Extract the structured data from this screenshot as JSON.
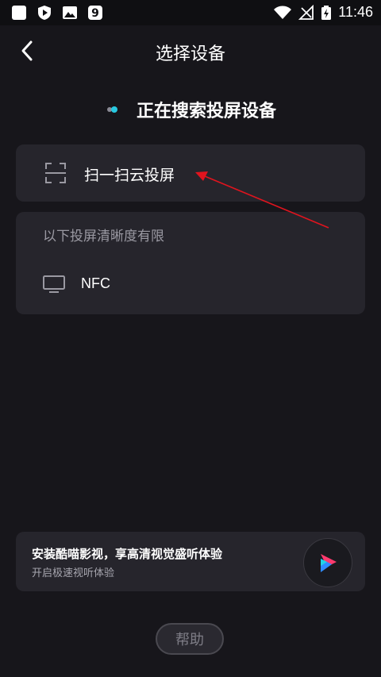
{
  "status_bar": {
    "time": "11:46"
  },
  "nav": {
    "title": "选择设备"
  },
  "searching": {
    "text": "正在搜索投屏设备"
  },
  "scan_card": {
    "label": "扫一扫云投屏"
  },
  "limited_card": {
    "label": "以下投屏清晰度有限",
    "nfc_label": "NFC"
  },
  "promo": {
    "title": "安装酷喵影视，享高清视觉盛听体验",
    "subtitle": "开启极速视听体验"
  },
  "help": {
    "label": "帮助"
  },
  "colors": {
    "background": "#17161b",
    "card": "#26252c",
    "accent_cyan": "#28c8e0",
    "annotation_arrow": "#e0141e"
  }
}
